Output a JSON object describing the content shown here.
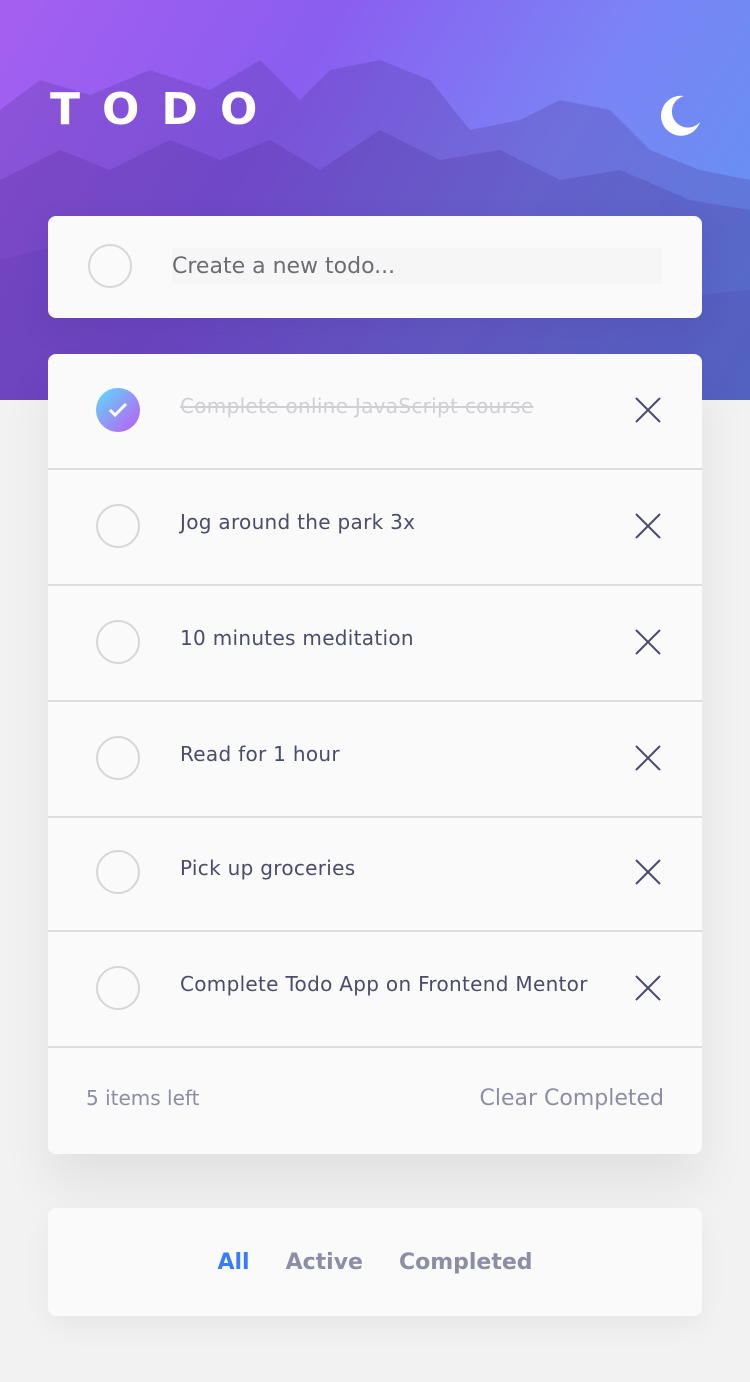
{
  "header": {
    "title": "TODO",
    "theme_toggle_icon": "moon-icon"
  },
  "create": {
    "placeholder": "Create a new todo..."
  },
  "todos": [
    {
      "text": "Complete online JavaScript course",
      "completed": true
    },
    {
      "text": "Jog around the park 3x",
      "completed": false
    },
    {
      "text": "10 minutes meditation",
      "completed": false
    },
    {
      "text": "Read for 1 hour",
      "completed": false
    },
    {
      "text": "Pick up groceries",
      "completed": false
    },
    {
      "text": "Complete Todo App on Frontend Mentor",
      "completed": false
    }
  ],
  "footer": {
    "items_left": "5 items left",
    "clear_label": "Clear Completed"
  },
  "filters": {
    "all": "All",
    "active": "Active",
    "completed": "Completed",
    "selected": "All"
  },
  "colors": {
    "accent": "#3a7bfd",
    "check_gradient_start": "#57ddff",
    "check_gradient_end": "#c058f3",
    "text": "#494c6b",
    "muted": "#8c8ea6"
  }
}
